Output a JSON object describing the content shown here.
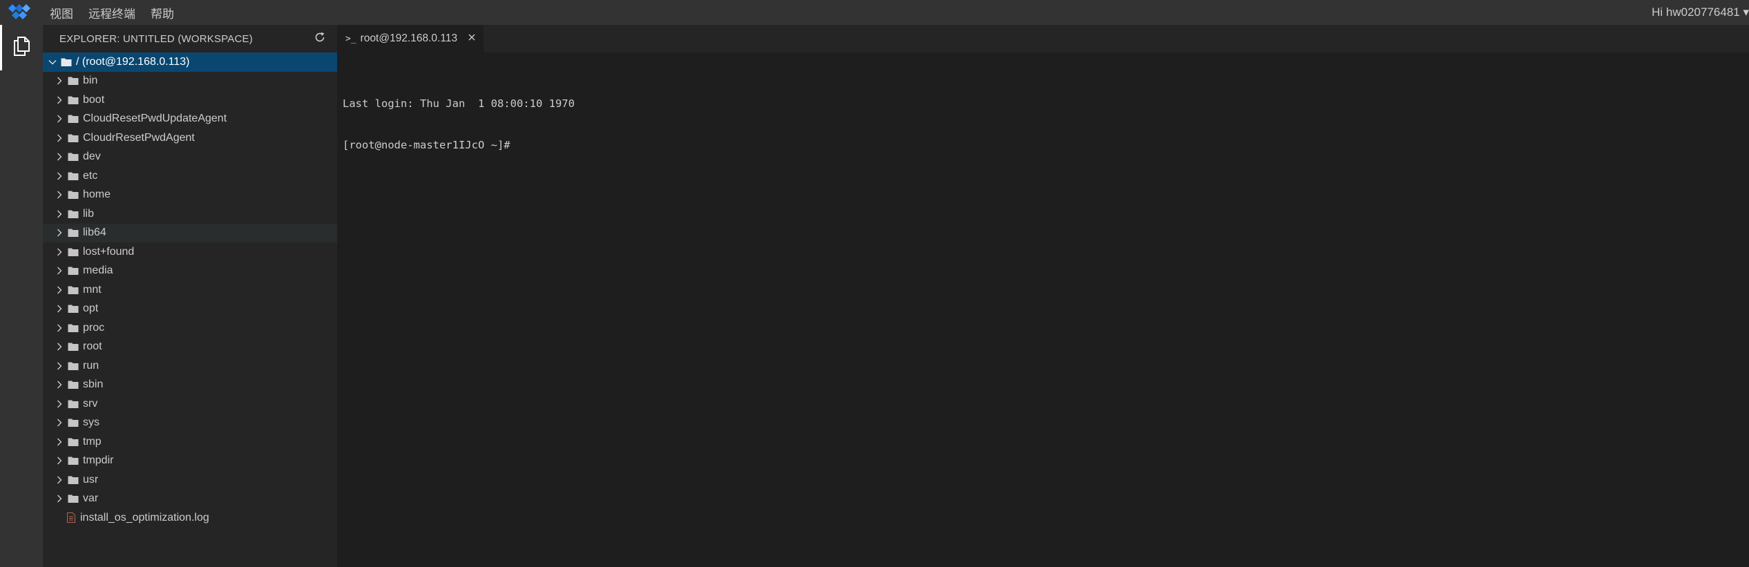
{
  "menubar": {
    "items": [
      "视图",
      "远程终端",
      "帮助"
    ],
    "greeting": "Hi hw020776481 ▾"
  },
  "activitybar": {
    "icons": [
      "explorer-icon"
    ]
  },
  "explorer": {
    "title": "EXPLORER: UNTITLED (WORKSPACE)",
    "root": "/ (root@192.168.0.113)",
    "folders": [
      "bin",
      "boot",
      "CloudResetPwdUpdateAgent",
      "CloudrResetPwdAgent",
      "dev",
      "etc",
      "home",
      "lib",
      "lib64",
      "lost+found",
      "media",
      "mnt",
      "opt",
      "proc",
      "root",
      "run",
      "sbin",
      "srv",
      "sys",
      "tmp",
      "tmpdir",
      "usr",
      "var"
    ],
    "files": [
      "install_os_optimization.log"
    ]
  },
  "editor": {
    "tab": {
      "prompt": ">_",
      "label": "root@192.168.0.113"
    },
    "terminal": {
      "lines": [
        "Last login: Thu Jan  1 08:00:10 1970",
        "[root@node-master1IJcO ~]#"
      ]
    }
  },
  "colors": {
    "menubar": "#333333",
    "sidebar": "#252526",
    "editor": "#1e1e1e",
    "selection": "#094771",
    "logo": "#1e7fd9"
  }
}
